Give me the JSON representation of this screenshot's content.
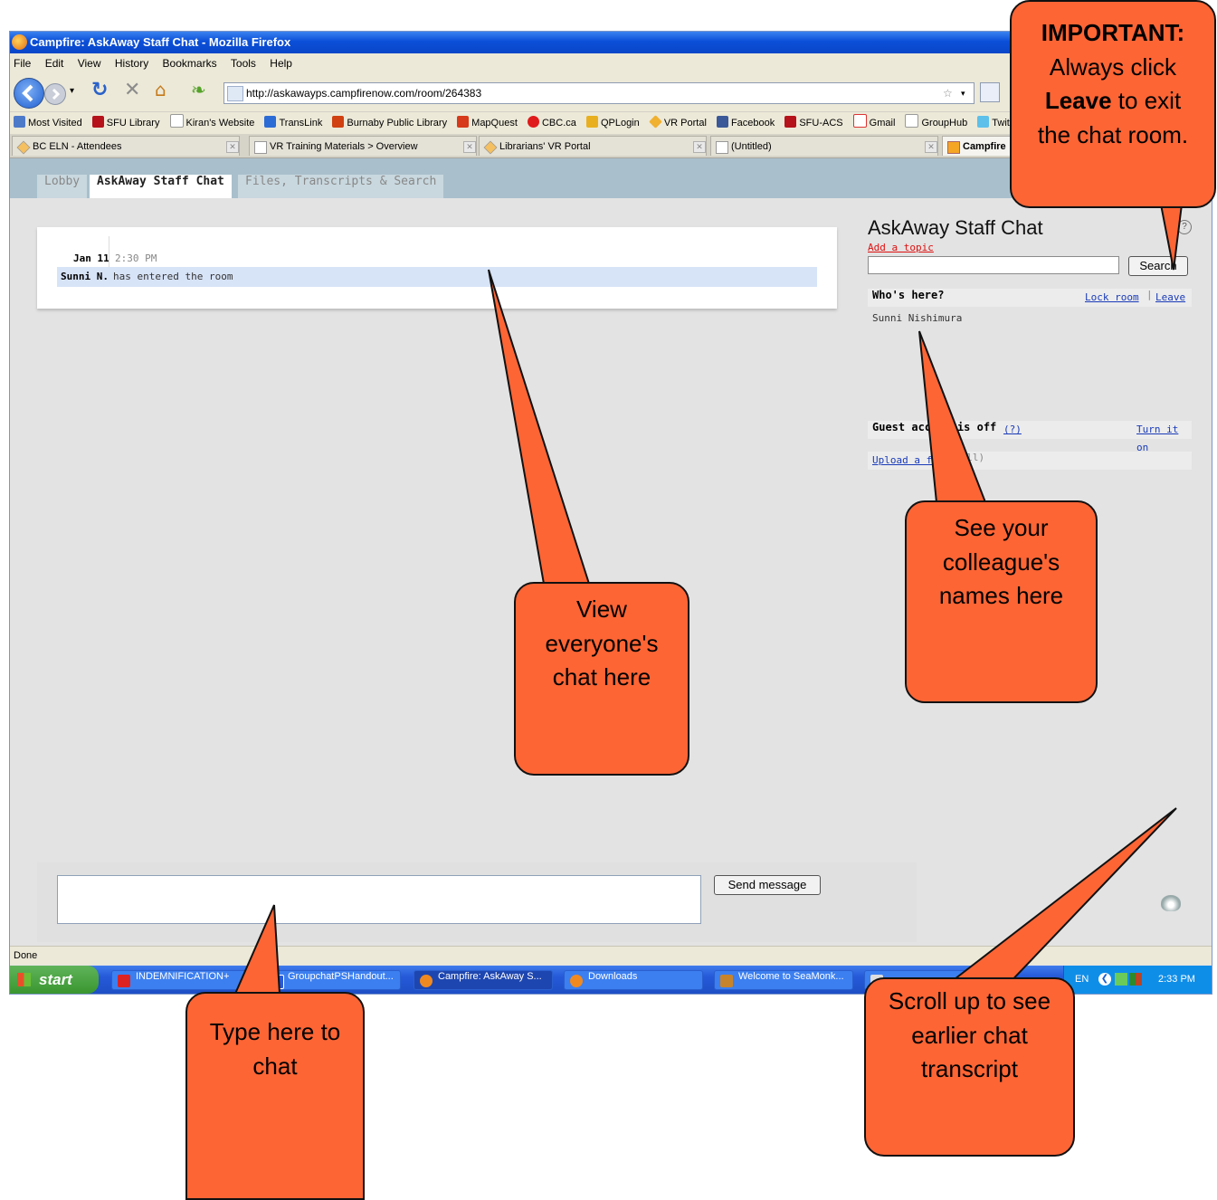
{
  "browser": {
    "title": "Campfire: AskAway Staff Chat - Mozilla Firefox",
    "menu": [
      "File",
      "Edit",
      "View",
      "History",
      "Bookmarks",
      "Tools",
      "Help"
    ],
    "url": "http://askawayps.campfirenow.com/room/264383",
    "bookmarks": [
      "Most Visited",
      "SFU Library",
      "Kiran's Website",
      "TransLink",
      "Burnaby Public Library",
      "MapQuest",
      "CBC.ca",
      "QPLogin",
      "VR Portal",
      "Facebook",
      "SFU-ACS",
      "Gmail",
      "GroupHub",
      "Twitte"
    ],
    "tabs": [
      "BC ELN - Attendees",
      "VR Training Materials > Overview",
      "Librarians' VR Portal",
      "(Untitled)",
      "Campfire"
    ],
    "status": "Done"
  },
  "room_tabs": [
    "Lobby",
    "AskAway Staff Chat",
    "Files, Transcripts & Search"
  ],
  "chat": {
    "date": "Jan 11",
    "time": "2:30 PM",
    "user": "Sunni N.",
    "message": "has entered the room"
  },
  "sidebar": {
    "room_title": "AskAway Staff Chat",
    "add_topic": "Add a topic",
    "search_button": "Search",
    "whos_here": "Who's here?",
    "lock_room": "Lock room",
    "separator": "|",
    "leave": "Leave",
    "user": "Sunni Nishimura",
    "guest_access": "Guest access is off",
    "guest_help": "(?)",
    "turn_on": "Turn it on",
    "upload": "Upload a file",
    "upload_extra": "(all)"
  },
  "composer": {
    "send_button": "Send message"
  },
  "taskbar": {
    "start": "start",
    "items": [
      "INDEMNIFICATION+",
      "GroupchatPSHandout...",
      "Campfire: AskAway S...",
      "Downloads",
      "Welcome to SeaMonk...",
      ""
    ],
    "lang": "EN",
    "clock": "2:33 PM"
  },
  "callouts": {
    "important_bold": "IMPORTANT:",
    "important_line1": "Always click",
    "important_leave": "Leave",
    "important_line2": "to exit",
    "important_line3": "the chat room.",
    "chat_line1": "View",
    "chat_line2": "everyone's",
    "chat_line3": "chat here",
    "names_line1": "See your",
    "names_line2": "colleague's",
    "names_line3": "names here",
    "type_line1": "Type here to",
    "type_line2": "chat",
    "scroll_line1": "Scroll up to see",
    "scroll_line2": "earlier chat",
    "scroll_line3": "transcript"
  },
  "colors": {
    "callout": "#fd6535",
    "accent_link": "#1a3bb8",
    "add_topic": "#e01010"
  }
}
